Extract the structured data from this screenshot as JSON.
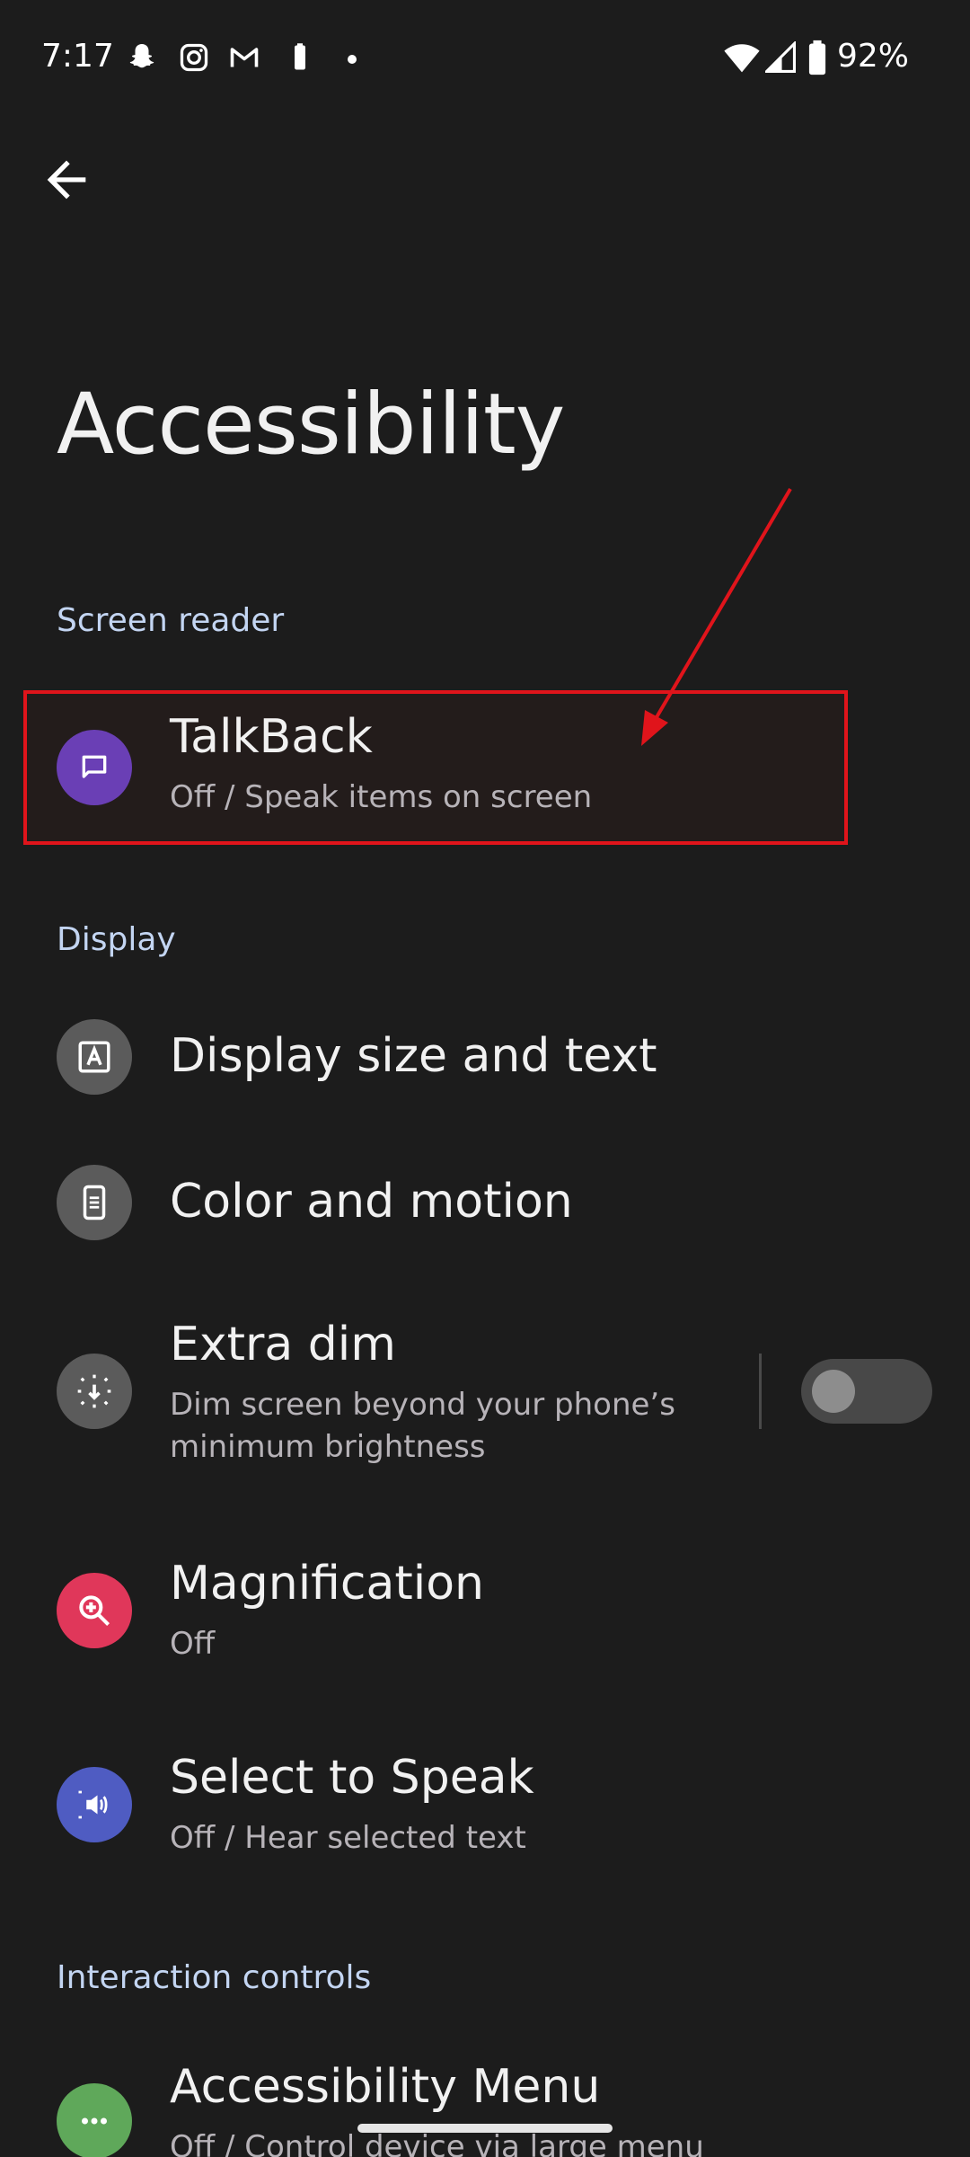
{
  "status_bar": {
    "time": "7:17",
    "battery_percent": "92%",
    "notification_icons": [
      "snapchat-icon",
      "instagram-icon",
      "gmail-icon",
      "battery-saver-icon",
      "dot-icon"
    ]
  },
  "page": {
    "title": "Accessibility"
  },
  "sections": {
    "screen_reader": {
      "header": "Screen reader"
    },
    "display": {
      "header": "Display"
    },
    "interaction": {
      "header": "Interaction controls"
    }
  },
  "items": {
    "talkback": {
      "title": "TalkBack",
      "subtitle": "Off / Speak items on screen",
      "icon": "chat-bubble-icon",
      "color": "#6a3fb5"
    },
    "display_size": {
      "title": "Display size and text",
      "icon": "text-format-icon",
      "color": "#5b5b5b"
    },
    "color_motion": {
      "title": "Color and motion",
      "icon": "phone-icon",
      "color": "#5b5b5b"
    },
    "extra_dim": {
      "title": "Extra dim",
      "subtitle_line1": "Dim screen beyond your phone’s",
      "subtitle_line2": "minimum brightness",
      "icon": "brightness-icon",
      "color": "#5b5b5b",
      "enabled": false
    },
    "magnification": {
      "title": "Magnification",
      "subtitle": "Off",
      "icon": "zoom-in-icon",
      "color": "#e0375a"
    },
    "select_to_speak": {
      "title": "Select to Speak",
      "subtitle": "Off / Hear selected text",
      "icon": "speaker-icon",
      "color": "#4f5cc2"
    },
    "accessibility_menu": {
      "title": "Accessibility Menu",
      "subtitle": "Off / Control device via large menu",
      "icon": "more-icon",
      "color": "#5fa85a"
    }
  },
  "annotation": {
    "highlight_color": "#e0141b"
  }
}
